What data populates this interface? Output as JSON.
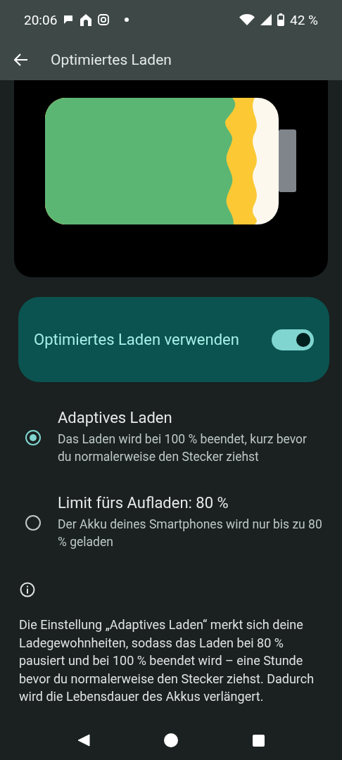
{
  "status_bar": {
    "time": "20:06",
    "battery": "42 %"
  },
  "toolbar": {
    "title": "Optimiertes Laden"
  },
  "main_switch": {
    "label": "Optimiertes Laden verwenden",
    "on": true
  },
  "options": [
    {
      "title": "Adaptives Laden",
      "summary": "Das Laden wird bei 100 % beendet, kurz bevor du normalerweise den Stecker ziehst",
      "selected": true
    },
    {
      "title": "Limit fürs Aufladen: 80 %",
      "summary": "Der Akku deines Smartphones wird nur bis zu 80 % geladen",
      "selected": false
    }
  ],
  "info_text": "Die Einstellung „Adaptives Laden“ merkt sich deine Ladegewohnheiten, sodass das Laden bei 80 % pausiert und bei 100 % beendet wird – eine Stunde bevor du normalerweise den Stecker ziehst. Dadurch wird die Lebensdauer des Akkus verlängert."
}
